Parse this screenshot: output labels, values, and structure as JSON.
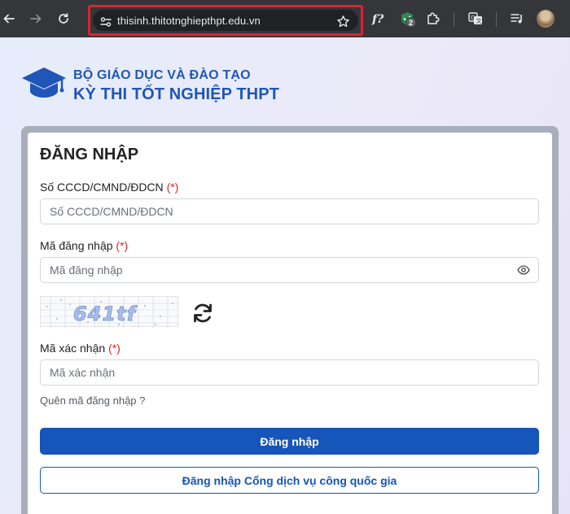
{
  "browser": {
    "url": "thisinh.thitotnghiepthpt.edu.vn",
    "extension_badge_count": "2",
    "icons": [
      "back-icon",
      "forward-icon",
      "reload-icon",
      "site-info-icon",
      "bookmark-star-icon",
      "fonts-extension-icon",
      "shield-extension-icon",
      "extensions-puzzle-icon",
      "translate-icon",
      "media-queue-icon",
      "profile-avatar"
    ],
    "highlight_color": "#e0222e"
  },
  "header": {
    "agency": "BỘ GIÁO DỤC VÀ ĐÀO TẠO",
    "exam_title": "KỲ THI TỐT NGHIỆP THPT",
    "brand_color": "#1f56b8"
  },
  "form": {
    "title": "ĐĂNG NHẬP",
    "id_label": "Số CCCD/CMND/ĐDCN",
    "id_placeholder": "Số CCCD/CMND/ĐDCN",
    "login_code_label": "Mã đăng nhập",
    "login_code_placeholder": "Mã đăng nhập",
    "captcha_text": "641tf",
    "verify_label": "Mã xác nhận",
    "verify_placeholder": "Mã xác nhận",
    "required_mark": "(*)",
    "forgot_link": "Quên mã đăng nhập ?",
    "login_button": "Đăng nhập",
    "national_portal_button": "Đăng nhập Cổng dịch vụ công quốc gia",
    "accent_color": "#1655b9"
  }
}
